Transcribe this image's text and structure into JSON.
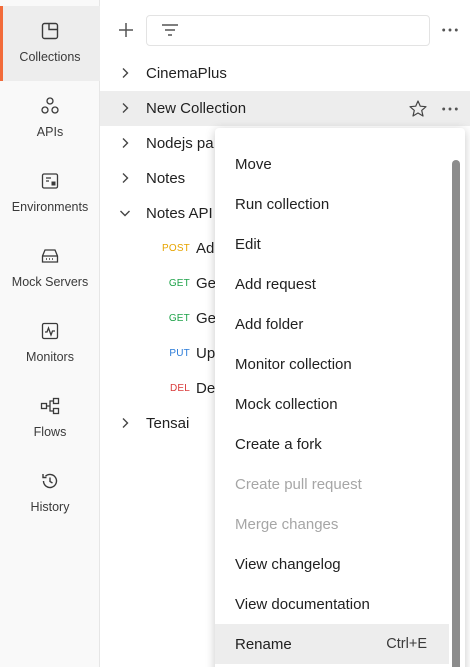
{
  "sidebar": {
    "items": [
      {
        "label": "Collections",
        "icon": "collections-icon",
        "active": true
      },
      {
        "label": "APIs",
        "icon": "apis-icon",
        "active": false
      },
      {
        "label": "Environments",
        "icon": "environments-icon",
        "active": false
      },
      {
        "label": "Mock Servers",
        "icon": "mock-servers-icon",
        "active": false
      },
      {
        "label": "Monitors",
        "icon": "monitors-icon",
        "active": false
      },
      {
        "label": "Flows",
        "icon": "flows-icon",
        "active": false
      },
      {
        "label": "History",
        "icon": "history-icon",
        "active": false
      }
    ]
  },
  "colors": {
    "accent": "#f26b3a",
    "post": "#e6a400",
    "get": "#1fa34a",
    "put": "#2a7bd8",
    "del": "#d93a3a"
  },
  "tree": {
    "collections": [
      {
        "name": "CinemaPlus",
        "expanded": false
      },
      {
        "name": "New Collection",
        "expanded": false
      },
      {
        "name": "Nodejs pa",
        "expanded": false
      },
      {
        "name": "Notes",
        "expanded": false
      },
      {
        "name": "Notes API",
        "expanded": true
      },
      {
        "name": "Tensai",
        "expanded": false
      }
    ],
    "requests": [
      {
        "method": "POST",
        "name": "Ad"
      },
      {
        "method": "GET",
        "name": "Ge"
      },
      {
        "method": "GET",
        "name": "Ge"
      },
      {
        "method": "PUT",
        "name": "Up"
      },
      {
        "method": "DEL",
        "name": "De"
      }
    ]
  },
  "menu": {
    "items": [
      {
        "label": "Move",
        "disabled": false
      },
      {
        "label": "Run collection",
        "disabled": false
      },
      {
        "label": "Edit",
        "disabled": false
      },
      {
        "label": "Add request",
        "disabled": false
      },
      {
        "label": "Add folder",
        "disabled": false
      },
      {
        "label": "Monitor collection",
        "disabled": false
      },
      {
        "label": "Mock collection",
        "disabled": false
      },
      {
        "label": "Create a fork",
        "disabled": false
      },
      {
        "label": "Create pull request",
        "disabled": true
      },
      {
        "label": "Merge changes",
        "disabled": true
      },
      {
        "label": "View changelog",
        "disabled": false
      },
      {
        "label": "View documentation",
        "disabled": false
      },
      {
        "label": "Rename",
        "disabled": false,
        "shortcut": "Ctrl+E"
      }
    ]
  }
}
